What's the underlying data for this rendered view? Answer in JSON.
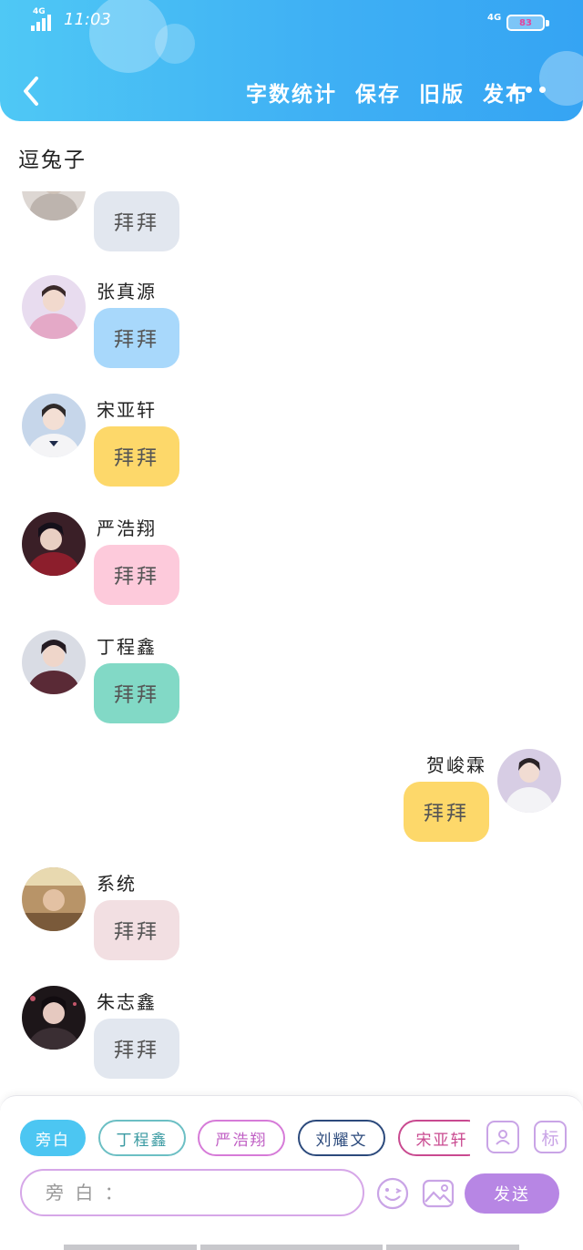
{
  "status_bar": {
    "network_left": "4G",
    "time": "11:03",
    "network_right": "4G",
    "battery": "83"
  },
  "header": {
    "back_label": "返回",
    "actions": [
      "字数统计",
      "保存",
      "旧版",
      "发布"
    ]
  },
  "chat": {
    "title": "逗兔子",
    "messages": [
      {
        "sender": "",
        "text": "拜拜",
        "side": "left",
        "bubble_color": "#e2e7ef",
        "avatar_color": "#c9c5c3"
      },
      {
        "sender": "张真源",
        "text": "拜拜",
        "side": "left",
        "bubble_color": "#a8d8fb",
        "avatar_color": "#d9b0cc"
      },
      {
        "sender": "宋亚轩",
        "text": "拜拜",
        "side": "left",
        "bubble_color": "#fdd86a",
        "avatar_color": "#b9cbe0"
      },
      {
        "sender": "严浩翔",
        "text": "拜拜",
        "side": "left",
        "bubble_color": "#fdcadb",
        "avatar_color": "#4a2630"
      },
      {
        "sender": "丁程鑫",
        "text": "拜拜",
        "side": "left",
        "bubble_color": "#82d9c6",
        "avatar_color": "#5a4d57"
      },
      {
        "sender": "贺峻霖",
        "text": "拜拜",
        "side": "right",
        "bubble_color": "#fdd86a",
        "avatar_color": "#d7cde4"
      },
      {
        "sender": "系统",
        "text": "拜拜",
        "side": "left",
        "bubble_color": "#f2dfe2",
        "avatar_color": "#a07c54"
      },
      {
        "sender": "朱志鑫",
        "text": "拜拜",
        "side": "left",
        "bubble_color": "#e2e7ef",
        "avatar_color": "#2b2226"
      }
    ]
  },
  "composer": {
    "characters": [
      {
        "label": "旁白",
        "active": true,
        "color": "#4cc6f2"
      },
      {
        "label": "丁程鑫",
        "active": false,
        "color": "#6cbfc4"
      },
      {
        "label": "严浩翔",
        "active": false,
        "color": "#d67bd8"
      },
      {
        "label": "刘耀文",
        "active": false,
        "color": "#2c4a7c"
      },
      {
        "label": "宋亚轩",
        "active": false,
        "color": "#c94a90"
      }
    ],
    "label_button": "标",
    "input_placeholder": "旁 白 ：",
    "send_label": "发送",
    "icons": [
      "contact-icon",
      "emoji-icon",
      "image-icon"
    ]
  }
}
